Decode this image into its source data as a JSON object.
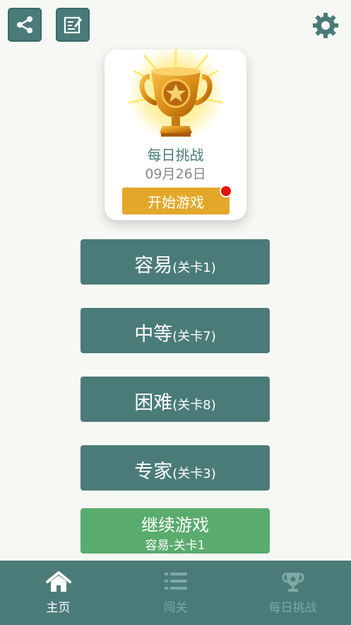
{
  "daily": {
    "title": "每日挑战",
    "date": "09月26日",
    "start_label": "开始游戏"
  },
  "levels": [
    {
      "name": "容易",
      "sub": "(关卡1)"
    },
    {
      "name": "中等",
      "sub": "(关卡7)"
    },
    {
      "name": "困难",
      "sub": "(关卡8)"
    },
    {
      "name": "专家",
      "sub": "(关卡3)"
    }
  ],
  "continue": {
    "title": "继续游戏",
    "sub": "容易-关卡1"
  },
  "tabs": [
    {
      "label": "主页",
      "icon": "home-icon",
      "active": true
    },
    {
      "label": "闯关",
      "icon": "list-icon",
      "active": false
    },
    {
      "label": "每日挑战",
      "icon": "trophy-icon",
      "active": false
    }
  ],
  "colors": {
    "background": "#f6f8f3",
    "primary": "#4a7b79",
    "accent": "#e3a82a",
    "continue": "#5aab6e",
    "notification": "#e8120e",
    "tab_inactive": "#7ea9a6"
  }
}
